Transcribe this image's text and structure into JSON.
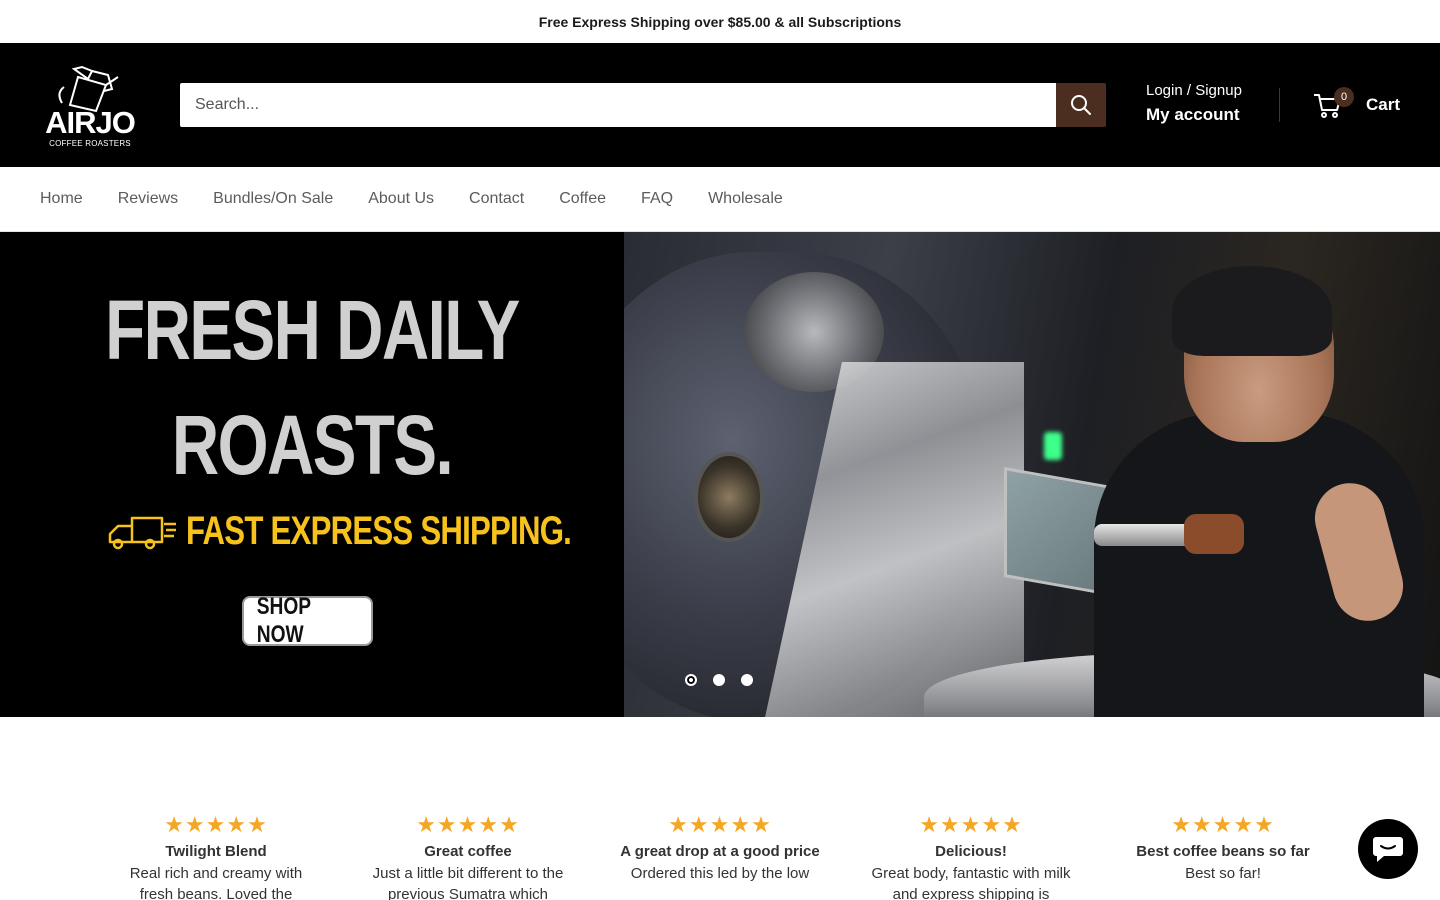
{
  "announcement": "Free Express Shipping over $85.00 & all Subscriptions",
  "logo": {
    "word": "AIRJO",
    "sub": "COFFEE ROASTERS"
  },
  "search": {
    "placeholder": "Search..."
  },
  "account": {
    "login": "Login / Signup",
    "my_account": "My account"
  },
  "cart": {
    "count": "0",
    "label": "Cart"
  },
  "nav": [
    "Home",
    "Reviews",
    "Bundles/On Sale",
    "About Us",
    "Contact",
    "Coffee",
    "FAQ",
    "Wholesale"
  ],
  "hero": {
    "line1": "FRESH DAILY",
    "line2": "ROASTS.",
    "shipping": "FAST EXPRESS SHIPPING.",
    "button": "SHOP NOW",
    "slides": 3,
    "active_slide": 1
  },
  "reviews": [
    {
      "stars": 5,
      "title": "Twilight Blend",
      "text": "Real rich and creamy with fresh beans. Loved the"
    },
    {
      "stars": 5,
      "title": "Great coffee",
      "text": "Just a little bit different to the previous Sumatra which"
    },
    {
      "stars": 5,
      "title": "A great drop at a good price",
      "text": "Ordered this led by the low"
    },
    {
      "stars": 5,
      "title": "Delicious!",
      "text": "Great body, fantastic with milk and express shipping is"
    },
    {
      "stars": 5,
      "title": "Best coffee beans so far",
      "text": "Best so far!"
    }
  ],
  "colors": {
    "accent": "#4b2e1f",
    "star": "#f5a623",
    "ship_yellow": "#f7c21c",
    "header_bg": "#000000"
  }
}
